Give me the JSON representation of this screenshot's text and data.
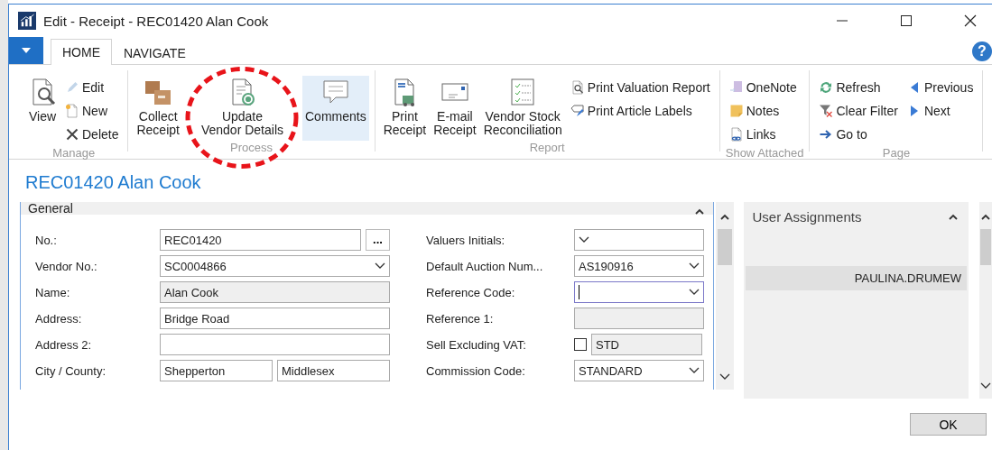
{
  "window": {
    "title": "Edit - Receipt - REC01420 Alan Cook"
  },
  "tabs": [
    {
      "label": "HOME",
      "selected": true
    },
    {
      "label": "NAVIGATE",
      "selected": false
    }
  ],
  "help": "?",
  "ribbon": {
    "groups": [
      {
        "label": "Manage",
        "items": [
          {
            "kind": "large",
            "label": "View",
            "disabled": false,
            "highlighted": false,
            "annotated": false
          },
          {
            "kind": "small",
            "label": "Edit",
            "disabled": true,
            "highlighted": false,
            "annotated": false
          },
          {
            "kind": "small",
            "label": "New",
            "disabled": false,
            "highlighted": false,
            "annotated": false
          },
          {
            "kind": "small",
            "label": "Delete",
            "disabled": false,
            "highlighted": false,
            "annotated": false
          }
        ]
      },
      {
        "label": "Process",
        "items": [
          {
            "kind": "large",
            "label": "Collect\nReceipt",
            "disabled": false,
            "highlighted": false,
            "annotated": false
          },
          {
            "kind": "large",
            "label": "Update\nVendor Details",
            "disabled": false,
            "highlighted": false,
            "annotated": true
          },
          {
            "kind": "large",
            "label": "Comments",
            "disabled": false,
            "highlighted": true,
            "annotated": false
          }
        ]
      },
      {
        "label": "Report",
        "items": [
          {
            "kind": "large",
            "label": "Print\nReceipt",
            "disabled": false,
            "highlighted": false,
            "annotated": false
          },
          {
            "kind": "large",
            "label": "E-mail\nReceipt",
            "disabled": false,
            "highlighted": false,
            "annotated": false
          },
          {
            "kind": "large",
            "label": "Vendor Stock\nReconciliation",
            "disabled": false,
            "highlighted": false,
            "annotated": false
          },
          {
            "kind": "small",
            "label": "Print Valuation Report",
            "disabled": false,
            "highlighted": false,
            "annotated": false
          },
          {
            "kind": "small",
            "label": "Print Article Labels",
            "disabled": false,
            "highlighted": false,
            "annotated": false
          }
        ]
      },
      {
        "label": "Show Attached",
        "items": [
          {
            "kind": "small",
            "label": "OneNote",
            "disabled": true,
            "highlighted": false,
            "annotated": false
          },
          {
            "kind": "small",
            "label": "Notes",
            "disabled": false,
            "highlighted": false,
            "annotated": false
          },
          {
            "kind": "small",
            "label": "Links",
            "disabled": false,
            "highlighted": false,
            "annotated": false
          }
        ]
      },
      {
        "label": "Page",
        "items": [
          {
            "kind": "small",
            "label": "Refresh",
            "disabled": false,
            "highlighted": false,
            "annotated": false
          },
          {
            "kind": "small",
            "label": "Clear Filter",
            "disabled": false,
            "highlighted": false,
            "annotated": false
          },
          {
            "kind": "small",
            "label": "Go to",
            "disabled": false,
            "highlighted": false,
            "annotated": false
          },
          {
            "kind": "small",
            "label": "Previous",
            "disabled": false,
            "highlighted": false,
            "annotated": false
          },
          {
            "kind": "small",
            "label": "Next",
            "disabled": false,
            "highlighted": false,
            "annotated": false
          }
        ]
      }
    ]
  },
  "page_title": "REC01420 Alan Cook",
  "general": {
    "title": "General",
    "expanded": true,
    "left_fields": [
      {
        "label": "No.:",
        "kind": "lookup",
        "value": "REC01420",
        "assist": "...",
        "focused": false
      },
      {
        "label": "Vendor No.:",
        "kind": "dropdown",
        "value": "SC0004866",
        "focused": false
      },
      {
        "label": "Name:",
        "kind": "readonly",
        "value": "Alan Cook",
        "focused": false
      },
      {
        "label": "Address:",
        "kind": "text",
        "value": "Bridge Road",
        "focused": false
      },
      {
        "label": "Address 2:",
        "kind": "text",
        "focused": false
      },
      {
        "label": "City / County:",
        "kind": "pair",
        "values": [
          "Shepperton",
          "Middlesex"
        ],
        "focused": false
      }
    ],
    "right_fields": [
      {
        "label": "Valuers Initials:",
        "kind": "dropdown",
        "focused": false
      },
      {
        "label": "Default Auction Num...",
        "kind": "dropdown",
        "value": "AS190916",
        "focused": false
      },
      {
        "label": "Reference Code:",
        "kind": "dropdown",
        "focused": true
      },
      {
        "label": "Reference 1:",
        "kind": "readonly",
        "focused": false
      },
      {
        "label": "Sell Excluding VAT:",
        "kind": "checkbox",
        "checked": false,
        "value": "STD",
        "focused": false
      },
      {
        "label": "Commission Code:",
        "kind": "dropdown",
        "value": "STANDARD",
        "focused": false
      }
    ]
  },
  "user_assignments": {
    "title": "User Assignments",
    "expanded": true,
    "rows": [
      {
        "name": "PAULINA.DRUMEW",
        "selected": true
      }
    ]
  },
  "buttons": [
    "OK"
  ]
}
